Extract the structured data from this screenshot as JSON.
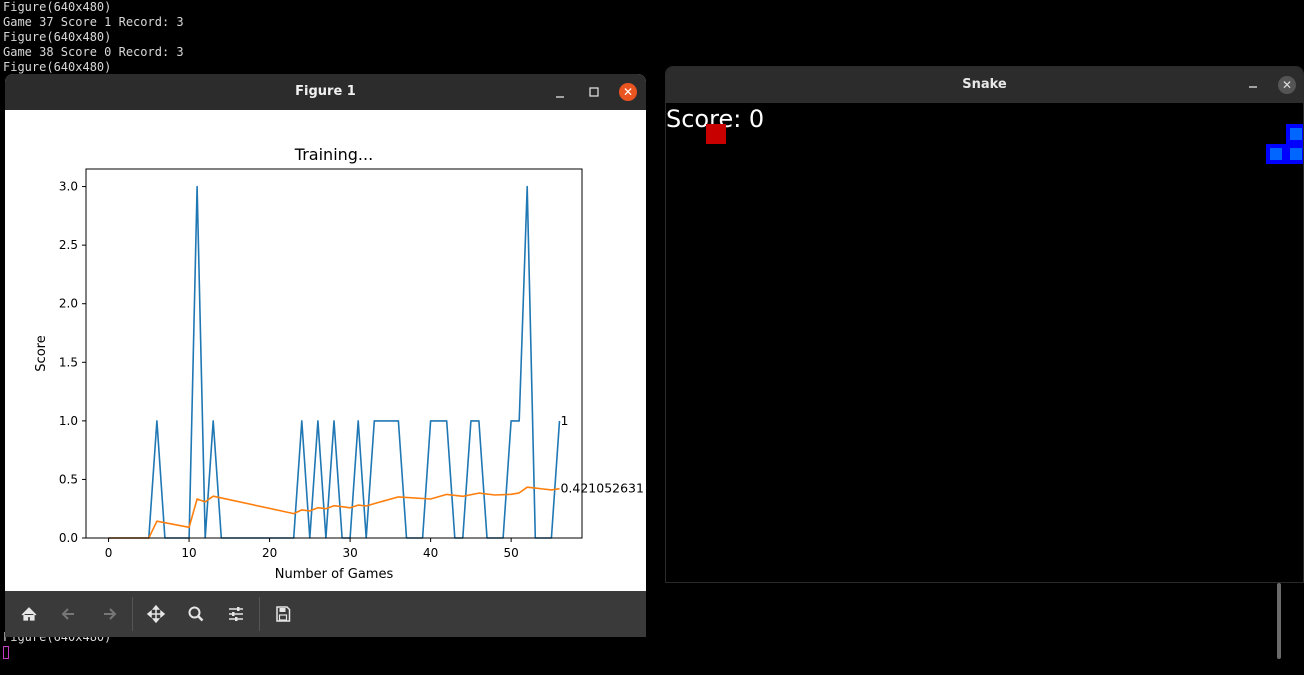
{
  "terminal": {
    "lines": [
      "Figure(640x480)",
      "Game 37 Score 1 Record: 3",
      "Figure(640x480)",
      "Game 38 Score 0 Record: 3",
      "Figure(640x480)"
    ],
    "bottom_line": "Figure(640x480)",
    "cursor_color": "#c33bc3"
  },
  "figure_window": {
    "title": "Figure 1",
    "minimize_icon": "minimize-icon",
    "maximize_icon": "maximize-icon",
    "close_icon": "close-icon",
    "toolbar": [
      {
        "icon": "home-icon",
        "enabled": true
      },
      {
        "icon": "back-arrow-icon",
        "enabled": false
      },
      {
        "icon": "forward-arrow-icon",
        "enabled": false
      },
      {
        "icon": "pan-move-icon",
        "enabled": true
      },
      {
        "icon": "zoom-magnifier-icon",
        "enabled": true
      },
      {
        "icon": "configure-subplots-icon",
        "enabled": true
      },
      {
        "icon": "save-floppy-icon",
        "enabled": true
      }
    ]
  },
  "chart_data": {
    "type": "line",
    "title": "Training...",
    "xlabel": "Number of Games",
    "ylabel": "Score",
    "xlim": [
      -2.8,
      58.8
    ],
    "ylim": [
      0,
      3.15
    ],
    "xticks": [
      "0",
      "10",
      "20",
      "30",
      "40",
      "50"
    ],
    "xtick_values": [
      0,
      10,
      20,
      30,
      40,
      50
    ],
    "yticks": [
      "0.0",
      "0.5",
      "1.0",
      "1.5",
      "2.0",
      "2.5",
      "3.0"
    ],
    "ytick_values": [
      0,
      0.5,
      1.0,
      1.5,
      2.0,
      2.5,
      3.0
    ],
    "grid": false,
    "series": [
      {
        "color": "#1f77b4",
        "x": [
          0,
          1,
          2,
          3,
          4,
          5,
          6,
          7,
          8,
          9,
          10,
          11,
          12,
          13,
          14,
          15,
          16,
          17,
          18,
          19,
          20,
          21,
          22,
          23,
          24,
          25,
          26,
          27,
          28,
          29,
          30,
          31,
          32,
          33,
          34,
          35,
          36,
          37,
          38,
          39,
          40,
          41,
          42,
          43,
          44,
          45,
          46,
          47,
          48,
          49,
          50,
          51,
          52,
          53,
          54,
          55,
          56
        ],
        "values": [
          0,
          0,
          0,
          0,
          0,
          0,
          1,
          0,
          0,
          0,
          0,
          3,
          0,
          1,
          0,
          0,
          0,
          0,
          0,
          0,
          0,
          0,
          0,
          0,
          1,
          0,
          1,
          0,
          1,
          0,
          0,
          1,
          0,
          1,
          1,
          1,
          1,
          0,
          0,
          0,
          1,
          1,
          1,
          0,
          0,
          1,
          1,
          0,
          0,
          0,
          1,
          1,
          3,
          0,
          0,
          0,
          1
        ],
        "end_label": "1"
      },
      {
        "color": "#ff7f0e",
        "x": [
          0,
          5,
          6,
          10,
          11,
          12,
          13,
          23,
          24,
          25,
          26,
          27,
          28,
          29,
          30,
          31,
          32,
          33,
          36,
          40,
          42,
          44,
          46,
          48,
          50,
          51,
          52,
          53,
          54,
          55,
          56
        ],
        "values": [
          0,
          0,
          0.143,
          0.091,
          0.333,
          0.308,
          0.357,
          0.208,
          0.24,
          0.231,
          0.259,
          0.25,
          0.276,
          0.267,
          0.258,
          0.281,
          0.273,
          0.294,
          0.351,
          0.333,
          0.372,
          0.356,
          0.383,
          0.367,
          0.373,
          0.385,
          0.434,
          0.426,
          0.418,
          0.411,
          0.421
        ],
        "end_label": "0.421052631"
      }
    ]
  },
  "snake_window": {
    "title": "Snake",
    "score_label": "Score: 0",
    "minimize_icon": "minimize-icon",
    "close_icon": "close-icon",
    "food_color": "#c80000",
    "snake_color": "#0000ff"
  }
}
